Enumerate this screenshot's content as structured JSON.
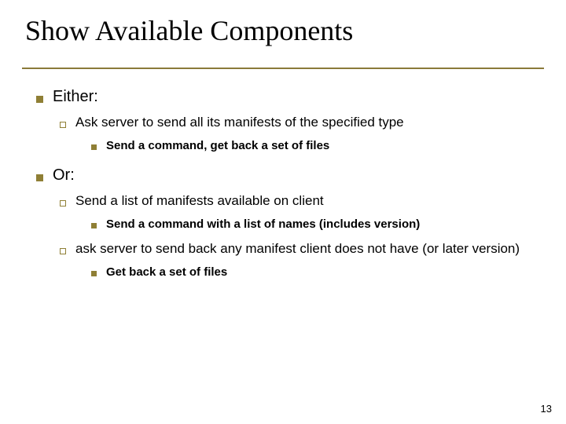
{
  "title": "Show Available Components",
  "bullets": {
    "either_label": "Either:",
    "either_item1": "Ask server to send all its manifests of the specified type",
    "either_item1_sub": "Send a command, get back a set of files",
    "or_label": "Or:",
    "or_item1": "Send a list of manifests available on client",
    "or_item1_sub": "Send a command with a list of names (includes version)",
    "or_item2": "ask server to send back any manifest client does not have (or later version)",
    "or_item2_sub": "Get back a set of files"
  },
  "page_number": "13"
}
